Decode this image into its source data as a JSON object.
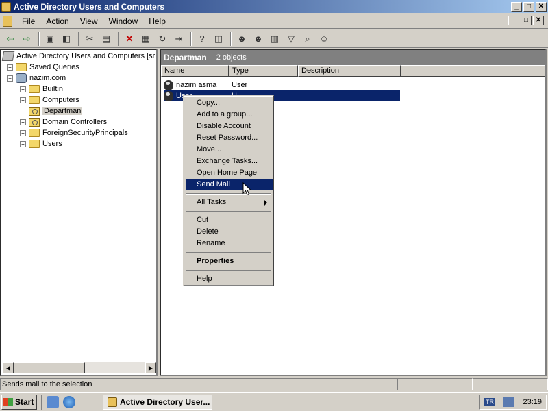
{
  "window": {
    "title": "Active Directory Users and Computers"
  },
  "menu": {
    "file": "File",
    "action": "Action",
    "view": "View",
    "window": "Window",
    "help": "Help"
  },
  "title_buttons": {
    "minimize": "_",
    "maximize": "□",
    "close": "✕"
  },
  "toolbar": {
    "icons": [
      "back-arrow-icon",
      "forward-arrow-icon",
      "up-folder-icon",
      "show-hide-tree-icon",
      "cut-icon",
      "paste-icon",
      "delete-icon",
      "properties-icon",
      "refresh-icon",
      "export-list-icon",
      "help-icon",
      "console-tree-icon",
      "create-user-icon",
      "create-group-icon",
      "create-ou-icon",
      "filter-icon",
      "find-icon",
      "add-to-group-icon"
    ]
  },
  "tree": {
    "root": "Active Directory Users and Computers [sr",
    "saved_queries": "Saved Queries",
    "domain": "nazim.com",
    "children": [
      "Builtin",
      "Computers",
      "Departman",
      "Domain Controllers",
      "ForeignSecurityPrincipals",
      "Users"
    ]
  },
  "right_pane": {
    "title": "Departman",
    "count": "2 objects",
    "columns": [
      "Name",
      "Type",
      "Description"
    ],
    "rows": [
      {
        "name": "nazim asma",
        "type": "User"
      },
      {
        "name": "User",
        "type": "U"
      }
    ]
  },
  "context_menu": {
    "copy": "Copy...",
    "add_group": "Add to a group...",
    "disable": "Disable Account",
    "reset_pw": "Reset Password...",
    "move": "Move...",
    "exchange": "Exchange Tasks...",
    "open_home": "Open Home Page",
    "send_mail": "Send Mail",
    "all_tasks": "All Tasks",
    "cut": "Cut",
    "delete": "Delete",
    "rename": "Rename",
    "properties": "Properties",
    "help": "Help"
  },
  "status": {
    "text": "Sends mail to the selection"
  },
  "taskbar": {
    "start": "Start",
    "task": "Active Directory User...",
    "lang": "TR",
    "time": "23:19"
  },
  "colors": {
    "titlebar": "#0a246a",
    "highlight": "#0a246a",
    "face": "#d4d0c8"
  }
}
